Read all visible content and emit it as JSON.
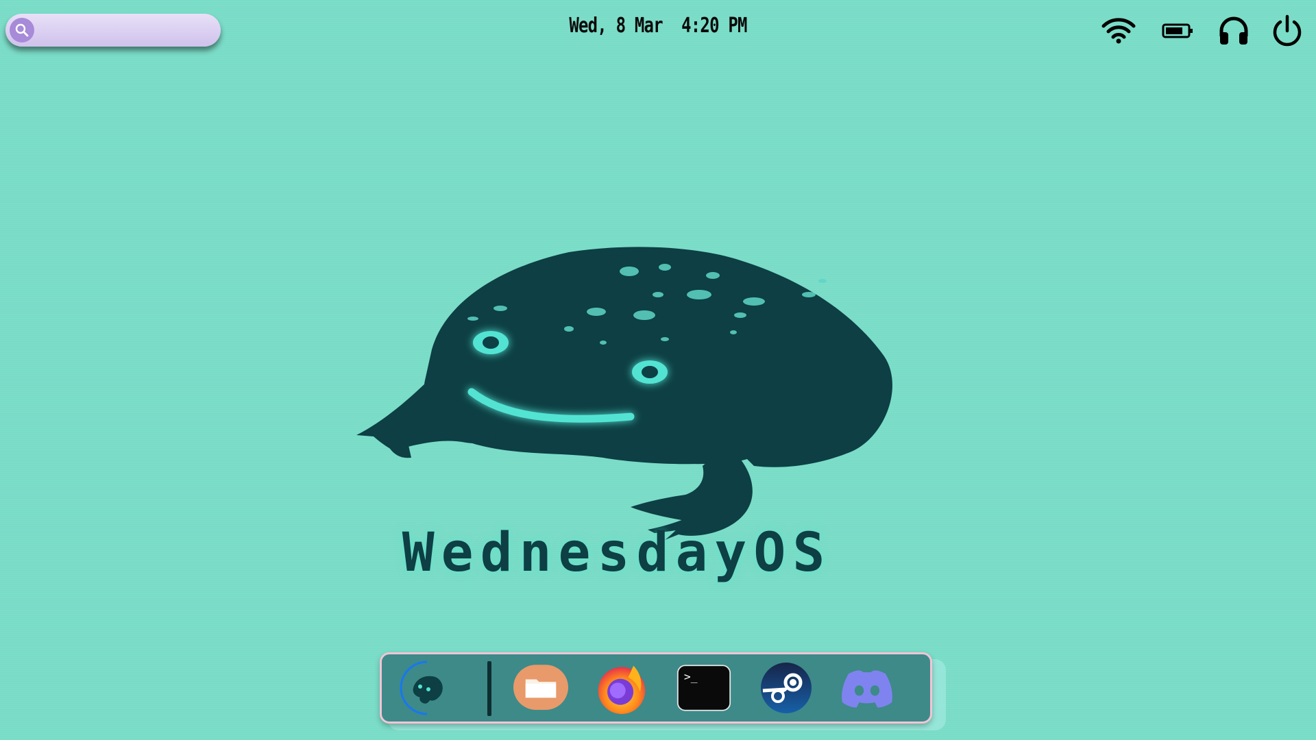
{
  "topbar": {
    "search": {
      "placeholder": "",
      "value": "",
      "icon": "search-icon"
    },
    "clock": "Wed, 8 Mar  4:20 PM",
    "tray": [
      "wifi-icon",
      "battery-icon",
      "headphones-icon",
      "power-icon"
    ]
  },
  "wallpaper": {
    "mascot": "frog-silhouette",
    "title": "WednesdayOS"
  },
  "dock": {
    "items": [
      {
        "name": "launcher",
        "icon": "frog-launcher-icon"
      },
      {
        "name": "files",
        "icon": "folder-icon"
      },
      {
        "name": "firefox",
        "icon": "firefox-icon"
      },
      {
        "name": "terminal",
        "icon": "terminal-icon",
        "glyph": ">_"
      },
      {
        "name": "steam",
        "icon": "steam-icon"
      },
      {
        "name": "discord",
        "icon": "discord-icon"
      }
    ]
  },
  "colors": {
    "background": "#79dcc7",
    "search_pill": "#d9cff2",
    "accent_purple": "#a78ad8",
    "mascot": "#0d3f44",
    "mascot_highlight": "#52e3d2",
    "dock": "#3d8a89",
    "dock_border": "#f2c4d6"
  }
}
